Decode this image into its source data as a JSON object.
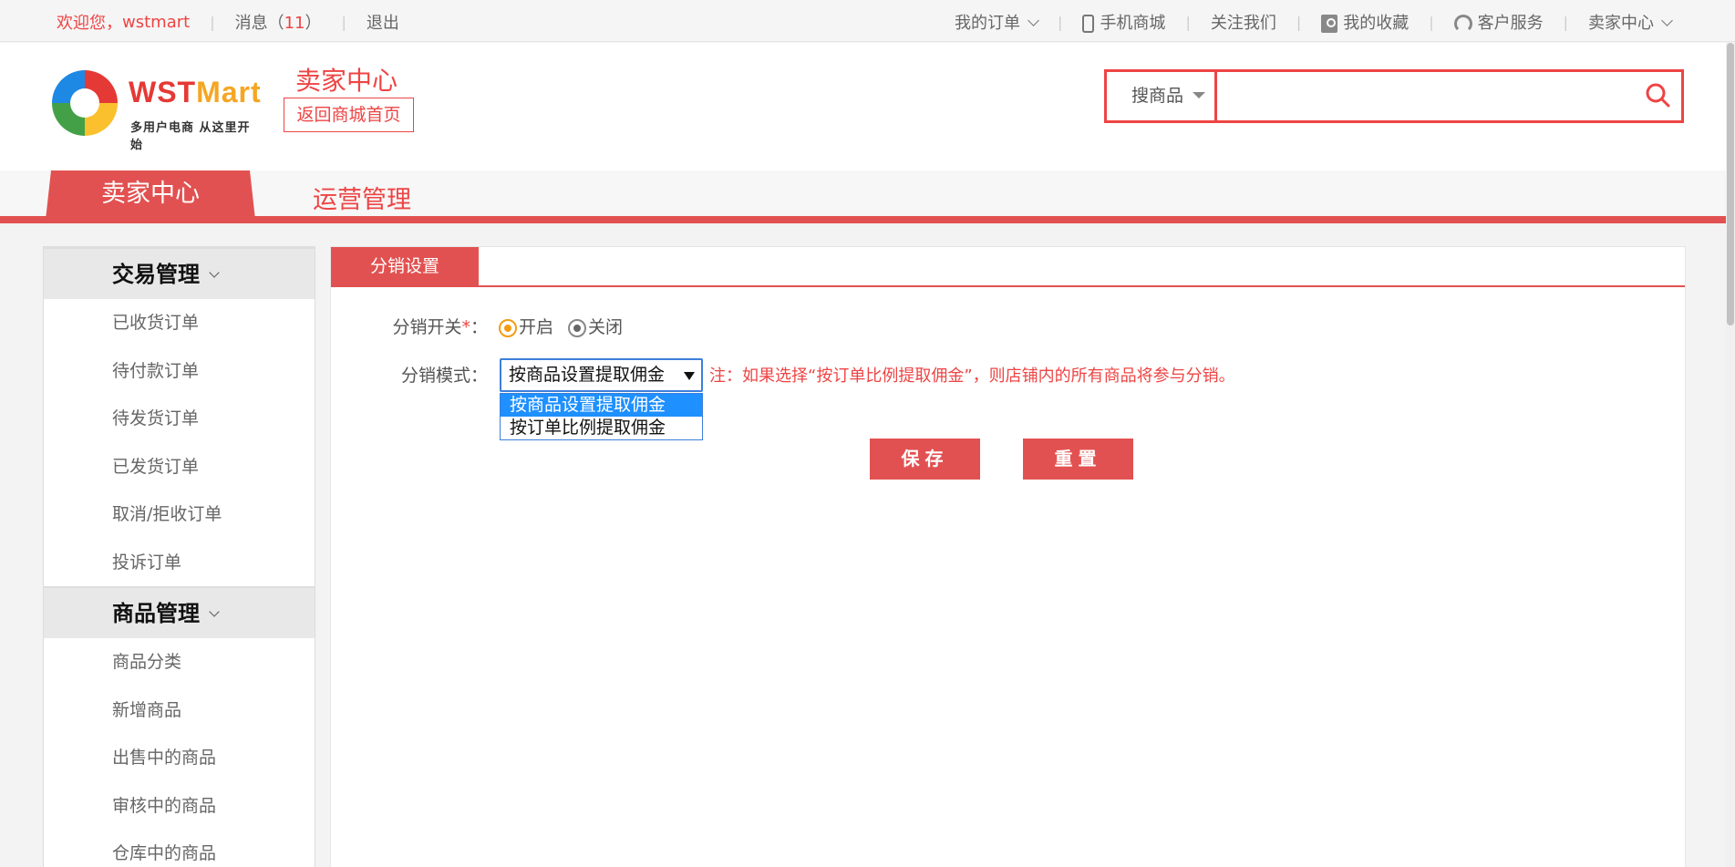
{
  "topbar": {
    "welcome": "欢迎您，",
    "username": "wstmart",
    "messages_label": "消息（",
    "messages_count": "11",
    "messages_close": "）",
    "logout": "退出",
    "my_orders": "我的订单",
    "mobile_mall": "手机商城",
    "follow_us": "关注我们",
    "favorites": "我的收藏",
    "customer_service": "客户服务",
    "seller_center": "卖家中心"
  },
  "header": {
    "logo_name_left": "WST",
    "logo_name_right": "Mart",
    "logo_slogan": "多用户电商 从这里开始",
    "seller_title": "卖家中心",
    "back_home": "返回商城首页",
    "search_category": "搜商品",
    "search_value": ""
  },
  "nav": {
    "active": "卖家中心",
    "ops": "运营管理"
  },
  "sidebar": {
    "groups": [
      {
        "title": "交易管理",
        "items": [
          "已收货订单",
          "待付款订单",
          "待发货订单",
          "已发货订单",
          "取消/拒收订单",
          "投诉订单"
        ]
      },
      {
        "title": "商品管理",
        "items": [
          "商品分类",
          "新增商品",
          "出售中的商品",
          "审核中的商品",
          "仓库中的商品"
        ]
      }
    ]
  },
  "panel": {
    "tab": "分销设置",
    "switch_label": "分销开关",
    "required_mark": "*",
    "colon": "：",
    "open_label": "开启",
    "close_label": "关闭",
    "mode_label": "分销模式：",
    "selected": "按商品设置提取佣金",
    "options": [
      "按商品设置提取佣金",
      "按订单比例提取佣金"
    ],
    "note": "注：如果选择“按订单比例提取佣金”，则店铺内的所有商品将参与分销。",
    "save": "保存",
    "reset": "重置"
  },
  "colors": {
    "accent": "#e25151",
    "option_highlight": "#1e90ff",
    "radio_on": "#f39c12"
  }
}
